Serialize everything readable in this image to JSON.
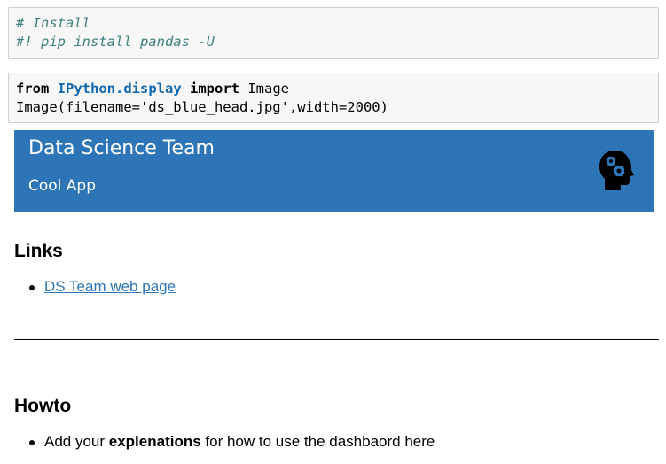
{
  "cells": {
    "install": {
      "line1": "# Install",
      "line2": "#! pip install pandas -U"
    },
    "image": {
      "kw_from": "from",
      "module": "IPython.display",
      "kw_import": "import",
      "name": "Image",
      "call_start": "Image(filename=",
      "filename_str": "'ds_blue_head.jpg'",
      "call_end": ",width=2000)"
    }
  },
  "banner": {
    "title": "Data Science Team",
    "subtitle": "Cool App",
    "logo_icon": "head-gears-icon",
    "color": "#2e75b7"
  },
  "links": {
    "heading": "Links",
    "items": [
      {
        "label": "DS Team web page"
      }
    ]
  },
  "howto": {
    "heading": "Howto",
    "item_prefix": "Add your ",
    "item_bold": "explenations",
    "item_suffix": " for how to use the dashbaord here"
  }
}
